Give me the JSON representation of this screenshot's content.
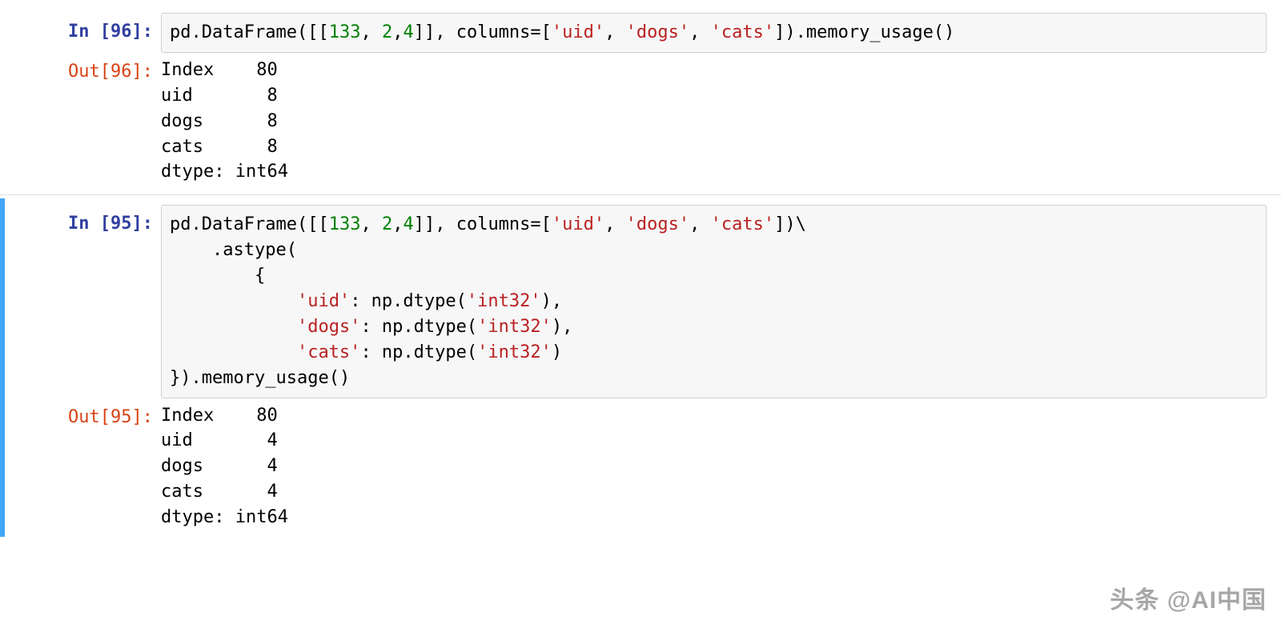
{
  "cells": [
    {
      "selected": false,
      "in_label": "In [96]:",
      "out_label": "Out[96]:",
      "code_segments": [
        {
          "t": "pd",
          "c": "code-token-name"
        },
        {
          "t": ".",
          "c": "code-token-punc"
        },
        {
          "t": "DataFrame",
          "c": "code-token-call"
        },
        {
          "t": "([[",
          "c": "code-token-paren"
        },
        {
          "t": "133",
          "c": "code-token-num"
        },
        {
          "t": ", ",
          "c": "code-token-punc"
        },
        {
          "t": "2",
          "c": "code-token-num"
        },
        {
          "t": ",",
          "c": "code-token-punc"
        },
        {
          "t": "4",
          "c": "code-token-num"
        },
        {
          "t": "]], ",
          "c": "code-token-punc"
        },
        {
          "t": "columns",
          "c": "code-token-name"
        },
        {
          "t": "=",
          "c": "code-token-eq"
        },
        {
          "t": "[",
          "c": "code-token-paren"
        },
        {
          "t": "'uid'",
          "c": "code-token-str"
        },
        {
          "t": ", ",
          "c": "code-token-punc"
        },
        {
          "t": "'dogs'",
          "c": "code-token-str"
        },
        {
          "t": ", ",
          "c": "code-token-punc"
        },
        {
          "t": "'cats'",
          "c": "code-token-str"
        },
        {
          "t": "])",
          "c": "code-token-paren"
        },
        {
          "t": ".",
          "c": "code-token-punc"
        },
        {
          "t": "memory_usage",
          "c": "code-token-call"
        },
        {
          "t": "()",
          "c": "code-token-paren"
        }
      ],
      "output_lines": [
        "Index    80",
        "uid       8",
        "dogs      8",
        "cats      8",
        "dtype: int64"
      ]
    },
    {
      "selected": true,
      "in_label": "In [95]:",
      "out_label": "Out[95]:",
      "code_segments": [
        {
          "t": "pd",
          "c": "code-token-name"
        },
        {
          "t": ".",
          "c": "code-token-punc"
        },
        {
          "t": "DataFrame",
          "c": "code-token-call"
        },
        {
          "t": "([[",
          "c": "code-token-paren"
        },
        {
          "t": "133",
          "c": "code-token-num"
        },
        {
          "t": ", ",
          "c": "code-token-punc"
        },
        {
          "t": "2",
          "c": "code-token-num"
        },
        {
          "t": ",",
          "c": "code-token-punc"
        },
        {
          "t": "4",
          "c": "code-token-num"
        },
        {
          "t": "]], ",
          "c": "code-token-punc"
        },
        {
          "t": "columns",
          "c": "code-token-name"
        },
        {
          "t": "=",
          "c": "code-token-eq"
        },
        {
          "t": "[",
          "c": "code-token-paren"
        },
        {
          "t": "'uid'",
          "c": "code-token-str"
        },
        {
          "t": ", ",
          "c": "code-token-punc"
        },
        {
          "t": "'dogs'",
          "c": "code-token-str"
        },
        {
          "t": ", ",
          "c": "code-token-punc"
        },
        {
          "t": "'cats'",
          "c": "code-token-str"
        },
        {
          "t": "])\\",
          "c": "code-token-paren"
        },
        {
          "t": "\n    ",
          "c": "code-token-plain"
        },
        {
          "t": ".",
          "c": "code-token-punc"
        },
        {
          "t": "astype",
          "c": "code-token-call"
        },
        {
          "t": "(",
          "c": "code-token-paren"
        },
        {
          "t": "\n        {",
          "c": "code-token-plain"
        },
        {
          "t": "\n            ",
          "c": "code-token-plain"
        },
        {
          "t": "'uid'",
          "c": "code-token-str"
        },
        {
          "t": ": np",
          "c": "code-token-name"
        },
        {
          "t": ".",
          "c": "code-token-punc"
        },
        {
          "t": "dtype",
          "c": "code-token-call"
        },
        {
          "t": "(",
          "c": "code-token-paren"
        },
        {
          "t": "'int32'",
          "c": "code-token-str"
        },
        {
          "t": "),",
          "c": "code-token-punc"
        },
        {
          "t": "\n            ",
          "c": "code-token-plain"
        },
        {
          "t": "'dogs'",
          "c": "code-token-str"
        },
        {
          "t": ": np",
          "c": "code-token-name"
        },
        {
          "t": ".",
          "c": "code-token-punc"
        },
        {
          "t": "dtype",
          "c": "code-token-call"
        },
        {
          "t": "(",
          "c": "code-token-paren"
        },
        {
          "t": "'int32'",
          "c": "code-token-str"
        },
        {
          "t": "),",
          "c": "code-token-punc"
        },
        {
          "t": "\n            ",
          "c": "code-token-plain"
        },
        {
          "t": "'cats'",
          "c": "code-token-str"
        },
        {
          "t": ": np",
          "c": "code-token-name"
        },
        {
          "t": ".",
          "c": "code-token-punc"
        },
        {
          "t": "dtype",
          "c": "code-token-call"
        },
        {
          "t": "(",
          "c": "code-token-paren"
        },
        {
          "t": "'int32'",
          "c": "code-token-str"
        },
        {
          "t": ")",
          "c": "code-token-punc"
        },
        {
          "t": "\n})",
          "c": "code-token-plain"
        },
        {
          "t": ".",
          "c": "code-token-punc"
        },
        {
          "t": "memory_usage",
          "c": "code-token-call"
        },
        {
          "t": "()",
          "c": "code-token-paren"
        }
      ],
      "output_lines": [
        "Index    80",
        "uid       4",
        "dogs      4",
        "cats      4",
        "dtype: int64"
      ]
    }
  ],
  "watermark": "头条 @AI中国"
}
